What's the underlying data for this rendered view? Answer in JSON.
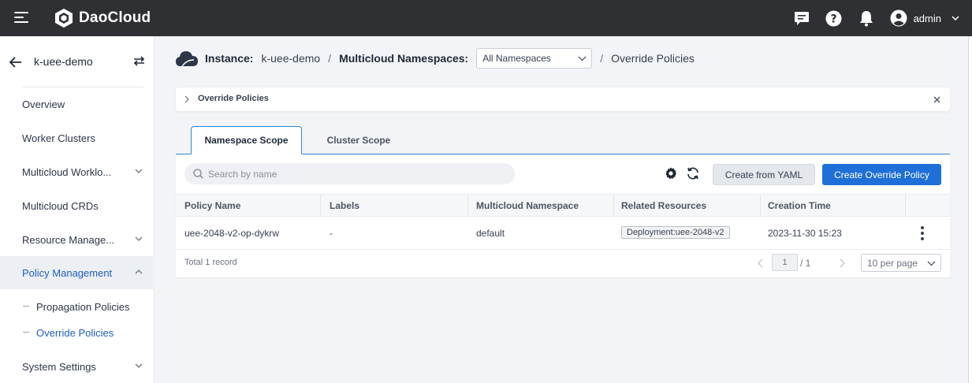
{
  "topbar": {
    "brand": "DaoCloud",
    "user_name": "admin",
    "icons": [
      "menu-icon",
      "message-icon",
      "help-icon",
      "bell-icon",
      "user-icon",
      "chevron-down-icon"
    ]
  },
  "sidebar": {
    "instance_name": "k-uee-demo",
    "items": [
      {
        "label": "Overview"
      },
      {
        "label": "Worker Clusters"
      },
      {
        "label": "Multicloud Worklo..."
      },
      {
        "label": "Multicloud CRDs"
      },
      {
        "label": "Resource Manage..."
      },
      {
        "label": "Policy Management"
      },
      {
        "label": "System Settings"
      }
    ],
    "sub_items": [
      {
        "label": "Propagation Policies"
      },
      {
        "label": "Override Policies"
      }
    ]
  },
  "breadcrumb": {
    "instance_label": "Instance:",
    "instance_value": "k-uee-demo",
    "separator": "/",
    "namespaces_label": "Multicloud Namespaces:",
    "namespace_selected": "All Namespaces",
    "current_page": "Override Policies"
  },
  "notice": {
    "title": "Override Policies"
  },
  "tabs": [
    {
      "label": "Namespace Scope",
      "active": true
    },
    {
      "label": "Cluster Scope",
      "active": false
    }
  ],
  "toolbar": {
    "search_placeholder": "Search by name",
    "create_yaml_label": "Create from YAML",
    "create_policy_label": "Create Override Policy"
  },
  "table": {
    "columns": [
      "Policy Name",
      "Labels",
      "Multicloud Namespace",
      "Related Resources",
      "Creation Time"
    ],
    "rows": [
      {
        "policy_name": "uee-2048-v2-op-dykrw",
        "labels": "-",
        "namespace": "default",
        "related_resources": "Deployment:uee-2048-v2",
        "creation_time": "2023-11-30 15:23"
      }
    ]
  },
  "pagination": {
    "total_text": "Total 1 record",
    "current_page": "1",
    "total_pages": "/ 1",
    "per_page": "10 per page"
  },
  "colors": {
    "topbar_bg": "#2f3033",
    "accent": "#1f6fd9",
    "active_nav": "#1f5fbf",
    "tab_border": "#2b8ad4"
  }
}
